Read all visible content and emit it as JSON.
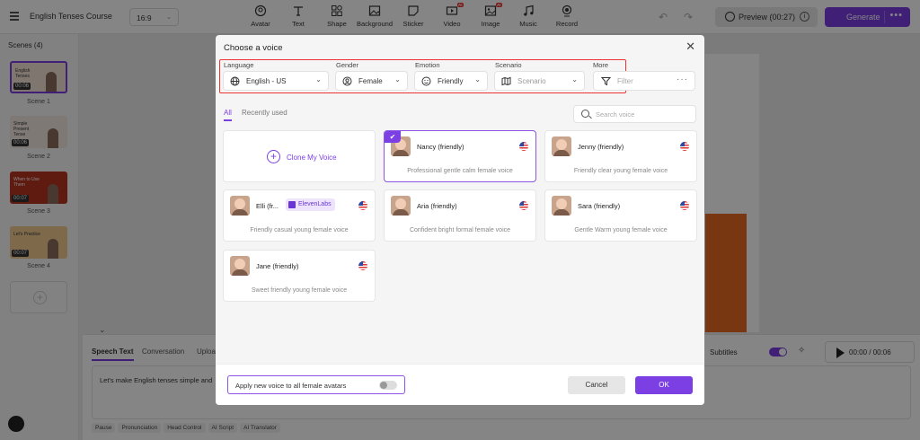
{
  "app": {
    "course_title": "English Tenses Course",
    "aspect_ratio": "16:9",
    "tools": [
      "Avatar",
      "Text",
      "Shape",
      "Background",
      "Sticker",
      "Video",
      "Image",
      "Music",
      "Record"
    ],
    "ai_badge": "AI",
    "preview_label": "Preview (00:27)",
    "generate_label": "Generate",
    "accent_color": "#7b3fe4"
  },
  "scenes": {
    "title": "Scenes (4)",
    "items": [
      {
        "label": "Scene 1",
        "duration": "00:06",
        "thumb_text": "English Tenses"
      },
      {
        "label": "Scene 2",
        "duration": "00:06",
        "thumb_text": "Simple Present Tense"
      },
      {
        "label": "Scene 3",
        "duration": "00:07",
        "thumb_text": "When to Use Them"
      },
      {
        "label": "Scene 4",
        "duration": "00:07",
        "thumb_text": "Let's Practice"
      }
    ]
  },
  "speech": {
    "tabs": [
      "Speech Text",
      "Conversation",
      "Uploa"
    ],
    "text": "Let's make English tenses simple and",
    "chips": [
      "Pause",
      "Pronunciation",
      "Head Control",
      "AI Script",
      "AI Translator"
    ],
    "subtitles_label": "Subtitles",
    "player_time": "00:00 / 00:06"
  },
  "modal": {
    "title": "Choose a voice",
    "filters": {
      "language": {
        "label": "Language",
        "value": "English - US"
      },
      "gender": {
        "label": "Gender",
        "value": "Female"
      },
      "emotion": {
        "label": "Emotion",
        "value": "Friendly"
      },
      "scenario": {
        "label": "Scenario",
        "value": "Scenario"
      },
      "more": {
        "label": "More",
        "value": "Filter"
      }
    },
    "tabs": {
      "all": "All",
      "recent": "Recently used"
    },
    "search_placeholder": "Search voice",
    "clone_label": "Clone My Voice",
    "voices": [
      {
        "name": "Nancy (friendly)",
        "desc": "Professional gentle calm female voice",
        "selected": true
      },
      {
        "name": "Jenny (friendly)",
        "desc": "Friendly clear young female voice"
      },
      {
        "name": "Elli (fr...",
        "desc": "Friendly casual young female voice",
        "badge": "ElevenLabs"
      },
      {
        "name": "Aria (friendly)",
        "desc": "Confident bright formal female voice"
      },
      {
        "name": "Sara (friendly)",
        "desc": "Gentle Warm young female voice"
      },
      {
        "name": "Jane (friendly)",
        "desc": "Sweet friendly young female voice"
      }
    ],
    "apply_label": "Apply new voice to all female avatars",
    "cancel_label": "Cancel",
    "ok_label": "OK"
  }
}
